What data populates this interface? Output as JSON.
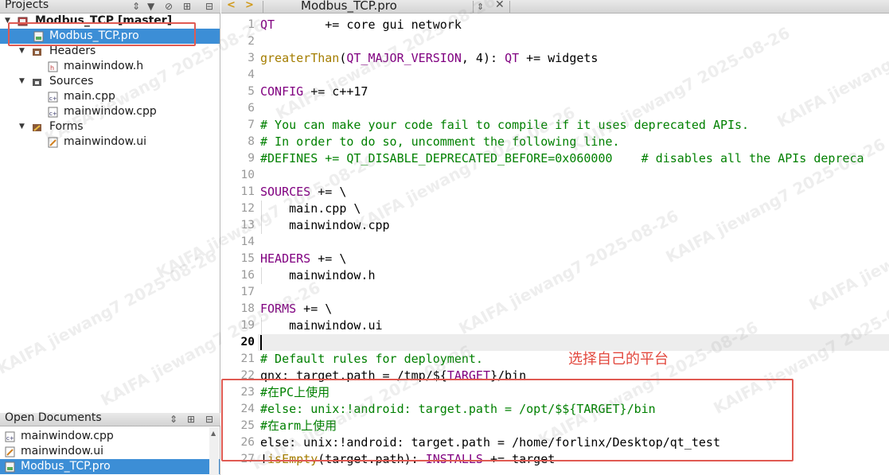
{
  "projects_panel": {
    "title": "Projects",
    "tree": [
      {
        "label": "Modbus_TCP [master]",
        "kind": "project"
      },
      {
        "label": "Modbus_TCP.pro",
        "kind": "pro-file",
        "selected": true
      },
      {
        "label": "Headers",
        "kind": "folder"
      },
      {
        "label": "mainwindow.h",
        "kind": "header-file"
      },
      {
        "label": "Sources",
        "kind": "folder"
      },
      {
        "label": "main.cpp",
        "kind": "cpp-file"
      },
      {
        "label": "mainwindow.cpp",
        "kind": "cpp-file"
      },
      {
        "label": "Forms",
        "kind": "folder"
      },
      {
        "label": "mainwindow.ui",
        "kind": "ui-file"
      }
    ]
  },
  "open_documents": {
    "title": "Open Documents",
    "items": [
      {
        "label": "mainwindow.cpp"
      },
      {
        "label": "mainwindow.ui"
      },
      {
        "label": "Modbus_TCP.pro",
        "selected": true
      }
    ]
  },
  "editor_tab": {
    "file": "Modbus_TCP.pro",
    "back_icon": "chevron-left-icon",
    "forward_icon": "chevron-right-icon",
    "close_icon": "close-icon"
  },
  "code": {
    "current_line": 20,
    "lines": [
      {
        "n": "1",
        "text": "QT       += core gui network"
      },
      {
        "n": "2",
        "text": ""
      },
      {
        "n": "3",
        "text": "greaterThan(QT_MAJOR_VERSION, 4): QT += widgets"
      },
      {
        "n": "4",
        "text": ""
      },
      {
        "n": "5",
        "text": "CONFIG += c++17"
      },
      {
        "n": "6",
        "text": ""
      },
      {
        "n": "7",
        "text": "# You can make your code fail to compile if it uses deprecated APIs."
      },
      {
        "n": "8",
        "text": "# In order to do so, uncomment the following line."
      },
      {
        "n": "9",
        "text": "#DEFINES += QT_DISABLE_DEPRECATED_BEFORE=0x060000    # disables all the APIs depreca"
      },
      {
        "n": "10",
        "text": ""
      },
      {
        "n": "11",
        "text": "SOURCES += \\"
      },
      {
        "n": "12",
        "text": "    main.cpp \\"
      },
      {
        "n": "13",
        "text": "    mainwindow.cpp"
      },
      {
        "n": "14",
        "text": ""
      },
      {
        "n": "15",
        "text": "HEADERS += \\"
      },
      {
        "n": "16",
        "text": "    mainwindow.h"
      },
      {
        "n": "17",
        "text": ""
      },
      {
        "n": "18",
        "text": "FORMS += \\"
      },
      {
        "n": "19",
        "text": "    mainwindow.ui"
      },
      {
        "n": "20",
        "text": ""
      },
      {
        "n": "21",
        "text": "# Default rules for deployment."
      },
      {
        "n": "22",
        "text": "qnx: target.path = /tmp/$${TARGET}/bin"
      },
      {
        "n": "23",
        "text": "#在PC上使用"
      },
      {
        "n": "24",
        "text": "#else: unix:!android: target.path = /opt/$${TARGET}/bin"
      },
      {
        "n": "25",
        "text": "#在arm上使用"
      },
      {
        "n": "26",
        "text": "else: unix:!android: target.path = /home/forlinx/Desktop/qt_test"
      },
      {
        "n": "27",
        "text": "!isEmpty(target.path): INSTALLS += target"
      }
    ]
  },
  "annotation": {
    "text": "选择自己的平台"
  },
  "watermark": {
    "text": "KAIFA  jiewang7  2025-08-26"
  },
  "colors": {
    "selection": "#3c8ed6",
    "keyword": "#800080",
    "function": "#a47d00",
    "comment": "#008000",
    "annotation_red": "#e05a52"
  }
}
